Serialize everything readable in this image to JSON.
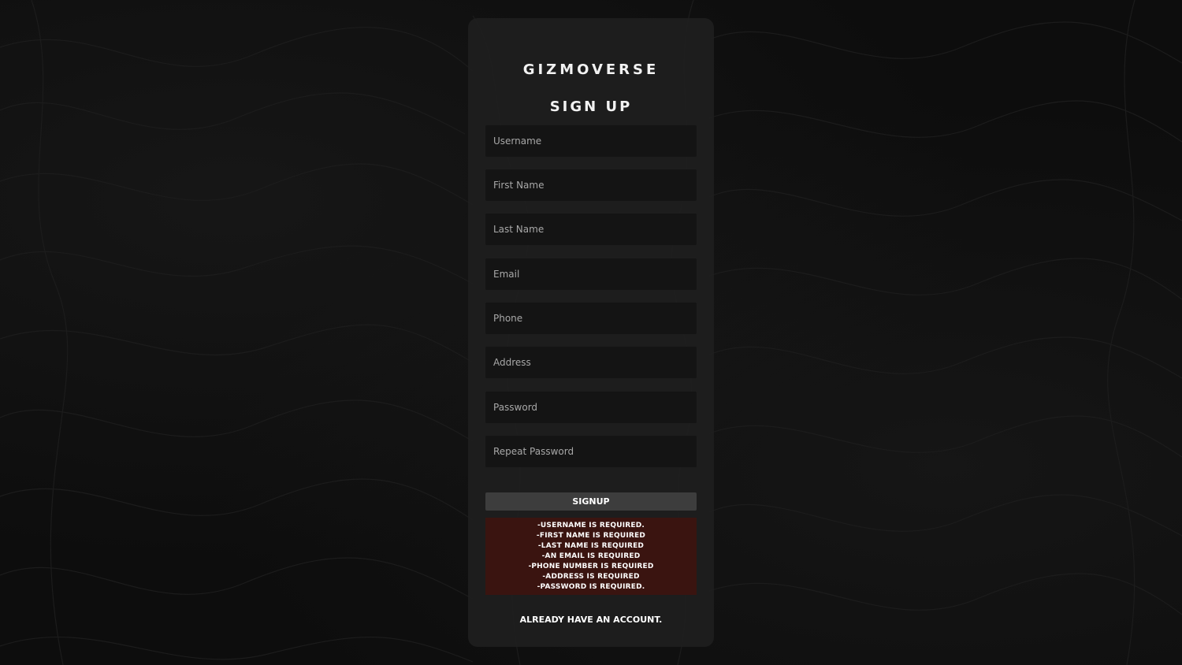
{
  "brand": "GIZMOVERSE",
  "form": {
    "title": "SIGN UP",
    "fields": [
      {
        "placeholder": "Username",
        "value": ""
      },
      {
        "placeholder": "First Name",
        "value": ""
      },
      {
        "placeholder": "Last Name",
        "value": ""
      },
      {
        "placeholder": "Email",
        "value": ""
      },
      {
        "placeholder": "Phone",
        "value": ""
      },
      {
        "placeholder": "Address",
        "value": ""
      },
      {
        "placeholder": "Password",
        "value": ""
      },
      {
        "placeholder": "Repeat Password",
        "value": ""
      }
    ],
    "submit_label": "SIGNUP",
    "errors": [
      "-USERNAME IS REQUIRED.",
      "-FIRST NAME IS REQUIRED",
      "-LAST NAME IS REQUIRED",
      "-AN EMAIL IS REQUIRED",
      "-PHONE NUMBER IS REQUIRED",
      "-ADDRESS IS REQUIRED",
      "-PASSWORD IS REQUIRED."
    ],
    "login_link": "ALREADY HAVE AN ACCOUNT."
  },
  "colors": {
    "background": "#0d0d0d",
    "card": "#1e1e1e",
    "input": "#141414",
    "button": "#3d3d3d",
    "error_box": "#3a1410"
  }
}
